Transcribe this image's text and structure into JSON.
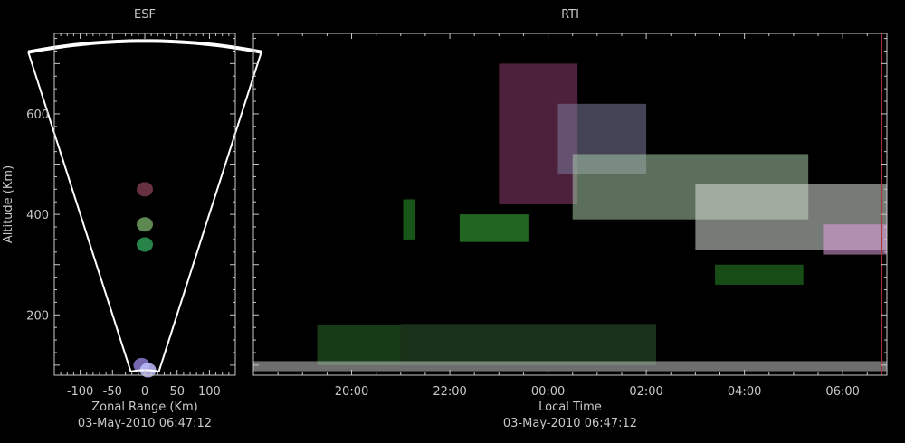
{
  "chart_data": [
    {
      "type": "heatmap",
      "title": "ESF",
      "xlabel": "Zonal Range (Km)",
      "ylabel": "Altitude (Km)",
      "subtitle": "03-May-2010 06:47:12",
      "xlim": [
        -140,
        140
      ],
      "ylim": [
        80,
        760
      ],
      "x_ticks": [
        -100,
        -50,
        0,
        50,
        100
      ],
      "x_tick_labels": [
        "-100",
        "-50",
        "0",
        "50",
        "100"
      ],
      "y_ticks": [
        200,
        400,
        600
      ],
      "y_tick_labels": [
        "200",
        "400",
        "600"
      ],
      "fan_half_angle_deg": 14,
      "fan_radius_min_km": 90,
      "fan_radius_max_km": 745,
      "echoes": [
        {
          "x": 0,
          "alt": 450,
          "color": "#7a3a4a"
        },
        {
          "x": 0,
          "alt": 380,
          "color": "#6fa060"
        },
        {
          "x": 0,
          "alt": 340,
          "color": "#2f9a55"
        },
        {
          "x": -5,
          "alt": 100,
          "color": "#8a7ad0"
        },
        {
          "x": 5,
          "alt": 90,
          "color": "#c0c0ff"
        }
      ]
    },
    {
      "type": "heatmap",
      "title": "RTI",
      "xlabel": "Local Time",
      "ylabel": "",
      "subtitle": "03-May-2010 06:47:12",
      "xlim_hours": [
        18.0,
        30.9
      ],
      "ylim": [
        80,
        760
      ],
      "x_ticks_hours": [
        20,
        22,
        24,
        26,
        28,
        30
      ],
      "x_tick_labels": [
        "20:00",
        "22:00",
        "00:00",
        "02:00",
        "04:00",
        "06:00"
      ],
      "y_ticks": [
        200,
        400,
        600
      ],
      "y_tick_labels": [
        "200",
        "400",
        "600"
      ],
      "echoes": [
        {
          "t0": 21.05,
          "t1": 21.3,
          "alt0": 350,
          "alt1": 430,
          "color": "#2c9a2c"
        },
        {
          "t0": 22.2,
          "t1": 23.6,
          "alt0": 345,
          "alt1": 400,
          "color": "#3ab83a"
        },
        {
          "t0": 23.0,
          "t1": 24.6,
          "alt0": 420,
          "alt1": 700,
          "color": "#8c3a6e"
        },
        {
          "t0": 24.2,
          "t1": 26.0,
          "alt0": 480,
          "alt1": 620,
          "color": "#7a7a9a"
        },
        {
          "t0": 24.5,
          "t1": 29.3,
          "alt0": 390,
          "alt1": 520,
          "color": "#a8c8a8"
        },
        {
          "t0": 27.0,
          "t1": 30.9,
          "alt0": 330,
          "alt1": 460,
          "color": "#d8e0d8"
        },
        {
          "t0": 29.6,
          "t1": 30.9,
          "alt0": 320,
          "alt1": 380,
          "color": "#e0a0e0"
        },
        {
          "t0": 27.4,
          "t1": 29.2,
          "alt0": 260,
          "alt1": 300,
          "color": "#2a8a2a"
        },
        {
          "t0": 19.3,
          "t1": 21.0,
          "alt0": 100,
          "alt1": 180,
          "color": "#2a6a2a"
        },
        {
          "t0": 21.0,
          "t1": 26.2,
          "alt0": 100,
          "alt1": 182,
          "color": "#2e5a2e"
        },
        {
          "t0": 18.0,
          "t1": 30.9,
          "alt0": 88,
          "alt1": 108,
          "color": "#c8c8c8"
        }
      ],
      "marker_line_hours": 30.8
    }
  ]
}
